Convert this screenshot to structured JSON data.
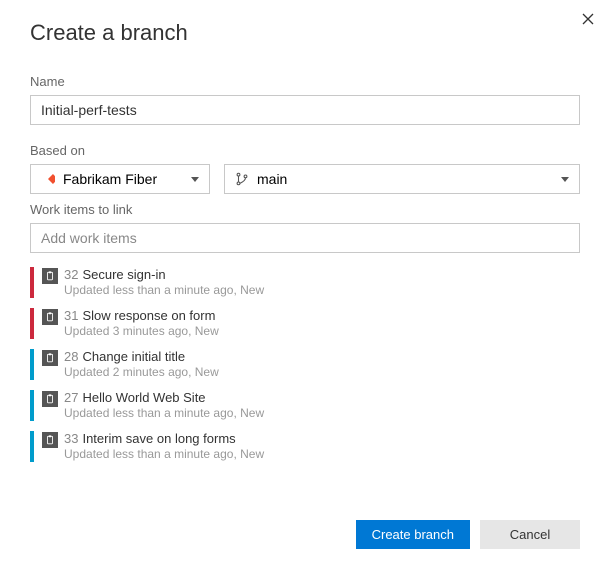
{
  "dialog": {
    "title": "Create a branch",
    "name_label": "Name",
    "name_value": "Initial-perf-tests",
    "based_on_label": "Based on",
    "repo_selected": "Fabrikam Fiber",
    "branch_selected": "main",
    "work_items_label": "Work items to link",
    "work_items_placeholder": "Add work items"
  },
  "work_items": [
    {
      "bar_color": "red",
      "id": "32",
      "title": "Secure sign-in",
      "meta": "Updated less than a minute ago, New"
    },
    {
      "bar_color": "red",
      "id": "31",
      "title": "Slow response on form",
      "meta": "Updated 3 minutes ago, New"
    },
    {
      "bar_color": "blue",
      "id": "28",
      "title": "Change initial title",
      "meta": "Updated 2 minutes ago, New"
    },
    {
      "bar_color": "blue",
      "id": "27",
      "title": "Hello World Web Site",
      "meta": "Updated less than a minute ago, New"
    },
    {
      "bar_color": "blue",
      "id": "33",
      "title": "Interim save on long forms",
      "meta": "Updated less than a minute ago, New"
    }
  ],
  "footer": {
    "primary": "Create branch",
    "secondary": "Cancel"
  }
}
